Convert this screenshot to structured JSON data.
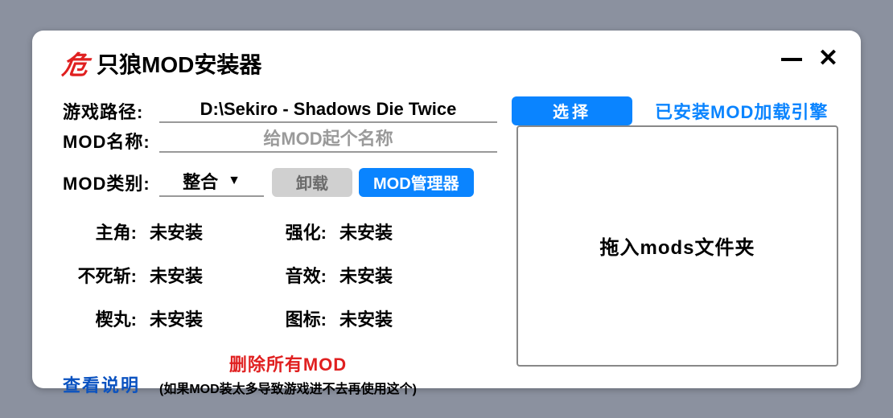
{
  "app": {
    "logo": "危",
    "title": "只狼MOD安装器"
  },
  "gamePath": {
    "label": "游戏路径:",
    "value": "D:\\Sekiro - Shadows Die Twice"
  },
  "selectBtn": "选择",
  "engineStatus": "已安装MOD加载引擎",
  "modName": {
    "label": "MOD名称:",
    "placeholder": "给MOD起个名称"
  },
  "modCategory": {
    "label": "MOD类别:",
    "selected": "整合"
  },
  "uninstallBtn": "卸载",
  "managerBtn": "MOD管理器",
  "status": {
    "protagonist": {
      "label": "主角:",
      "value": "未安装"
    },
    "immortal": {
      "label": "不死斩:",
      "value": "未安装"
    },
    "kusabi": {
      "label": "楔丸:",
      "value": "未安装"
    },
    "enhance": {
      "label": "强化:",
      "value": "未安装"
    },
    "sound": {
      "label": "音效:",
      "value": "未安装"
    },
    "icon": {
      "label": "图标:",
      "value": "未安装"
    }
  },
  "viewHelp": "查看说明",
  "deleteAll": {
    "title": "删除所有MOD",
    "note": "(如果MOD装太多导致游戏进不去再使用这个)"
  },
  "dropzone": "拖入mods文件夹"
}
